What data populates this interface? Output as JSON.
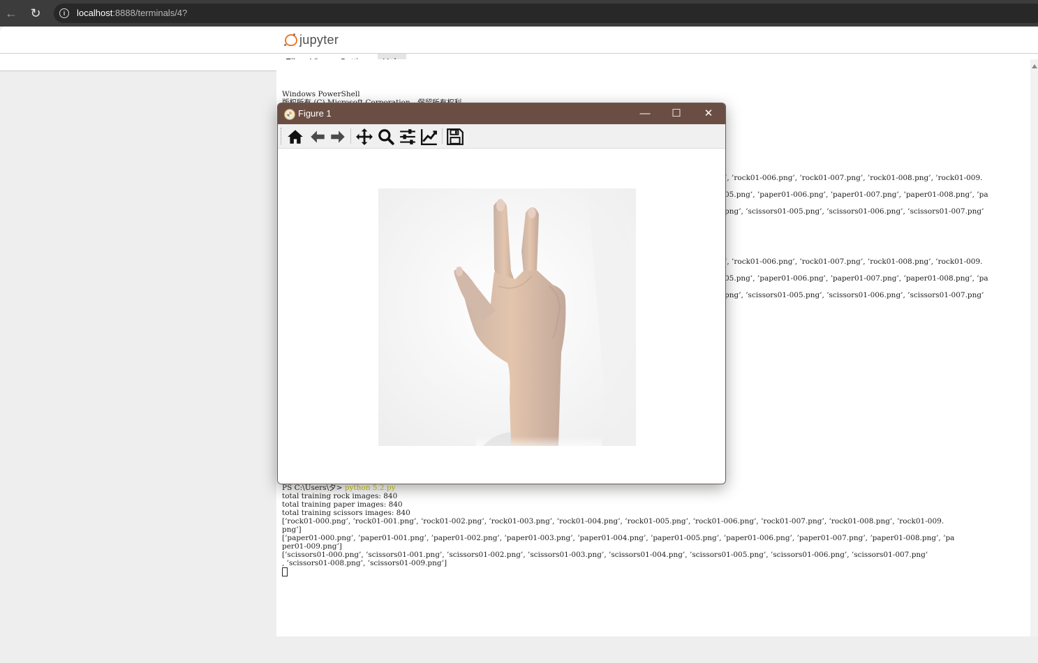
{
  "browser": {
    "url_host": "localhost",
    "url_rest": ":8888/terminals/4?"
  },
  "jupyter": {
    "logo_text": "jupyter",
    "menu": [
      "File",
      "View",
      "Settings",
      "Help"
    ],
    "active_menu": "Help"
  },
  "terminal": {
    "top_lines": [
      "Windows PowerShell",
      "版权所有 (C) Microsoft Corporation。保留所有权利。"
    ],
    "partial_blocks": [
      [
        "’, ’rock01-006.png’, ’rock01-007.png’, ’rock01-008.png’, ’rock01-009.",
        "05.png’, ’paper01-006.png’, ’paper01-007.png’, ’paper01-008.png’, ’pa",
        "png’, ’scissors01-005.png’, ’scissors01-006.png’, ’scissors01-007.png’"
      ],
      [
        "’, ’rock01-006.png’, ’rock01-007.png’, ’rock01-008.png’, ’rock01-009.",
        "05.png’, ’paper01-006.png’, ’paper01-007.png’, ’paper01-008.png’, ’pa",
        "png’, ’scissors01-005.png’, ’scissors01-006.png’, ’scissors01-007.png’"
      ]
    ],
    "prompt": "PS C:\\Users\\夕> ",
    "command": "python 5.2.py",
    "output_lines": [
      "total training rock images: 840",
      "total training paper images: 840",
      "total training scissors images: 840",
      "[’rock01-000.png’, ’rock01-001.png’, ’rock01-002.png’, ’rock01-003.png’, ’rock01-004.png’, ’rock01-005.png’, ’rock01-006.png’, ’rock01-007.png’, ’rock01-008.png’, ’rock01-009.",
      "png’]",
      "[’paper01-000.png’, ’paper01-001.png’, ’paper01-002.png’, ’paper01-003.png’, ’paper01-004.png’, ’paper01-005.png’, ’paper01-006.png’, ’paper01-007.png’, ’paper01-008.png’, ’pa",
      "per01-009.png’]",
      "[’scissors01-000.png’, ’scissors01-001.png’, ’scissors01-002.png’, ’scissors01-003.png’, ’scissors01-004.png’, ’scissors01-005.png’, ’scissors01-006.png’, ’scissors01-007.png’",
      ", ’scissors01-008.png’, ’scissors01-009.png’]"
    ]
  },
  "figure_window": {
    "title": "Figure 1",
    "minimize": "—",
    "maximize": "☐",
    "close": "✕",
    "toolbar_icons": [
      "home-icon",
      "back-arrow-icon",
      "forward-arrow-icon",
      "pan-move-icon",
      "zoom-magnifier-icon",
      "configure-subplots-icon",
      "edit-axis-icon",
      "save-floppy-icon"
    ],
    "image_subject": "hand showing scissors gesture"
  },
  "colors": {
    "titlebar": "#6b4e43",
    "logo_orange": "#f37726",
    "prompt_command": "#c8c800"
  }
}
